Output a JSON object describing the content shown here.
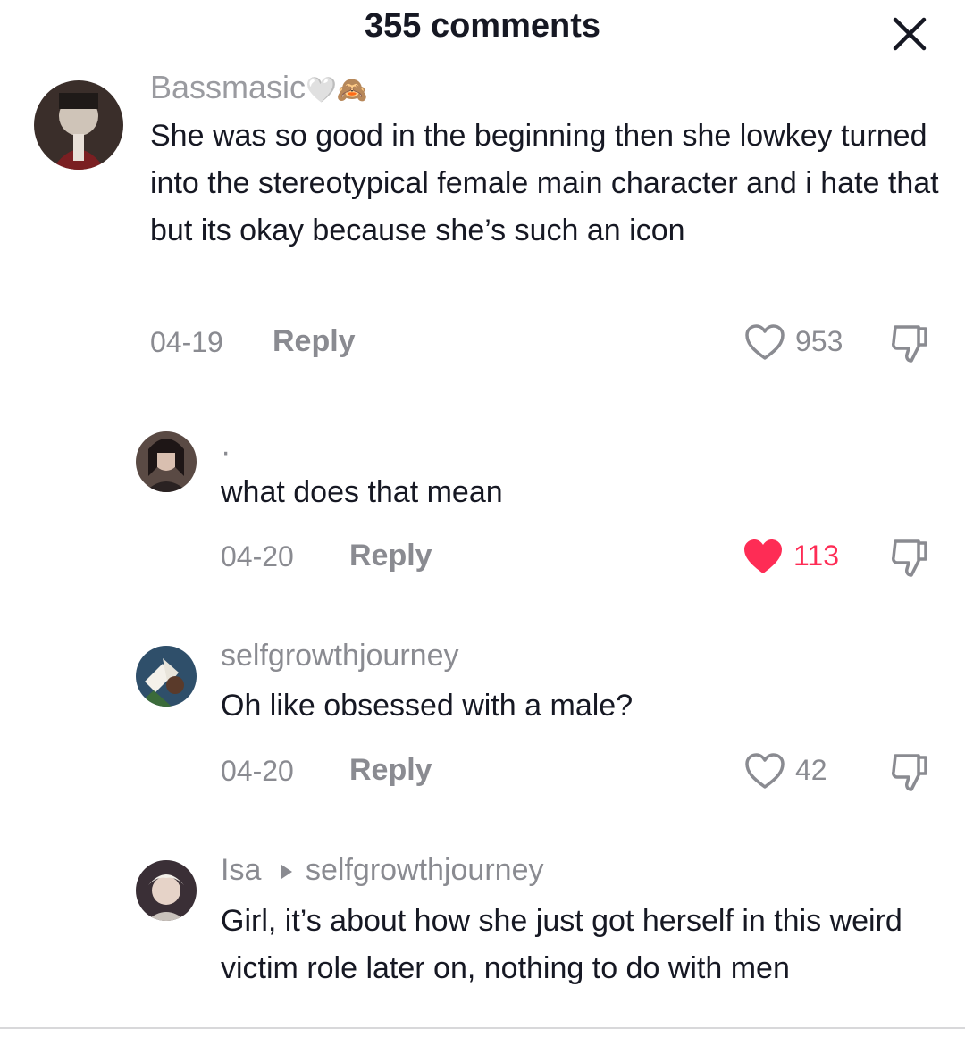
{
  "header": {
    "title": "355 comments",
    "close_icon": "close-icon"
  },
  "colors": {
    "liked": "#fe2c55",
    "muted": "#8a8b91",
    "text": "#161823"
  },
  "comments": [
    {
      "username": "Bassmasic",
      "username_emoji": "🤍🙈",
      "text": "She was so good in the beginning then she lowkey turned into the stereotypical female main character and i hate that but its okay because she’s such an icon",
      "date": "04-19",
      "reply_label": "Reply",
      "likes": "953",
      "liked": false
    },
    {
      "username": "·",
      "text": "what does that mean",
      "date": "04-20",
      "reply_label": "Reply",
      "likes": "113",
      "liked": true
    },
    {
      "username": "selfgrowthjourney",
      "text": "Oh like obsessed with a male?",
      "date": "04-20",
      "reply_label": "Reply",
      "likes": "42",
      "liked": false
    },
    {
      "username": "Isa",
      "reply_to": "selfgrowthjourney",
      "text": "Girl, it’s about how she just got herself in this weird victim role later on, nothing to do with men"
    }
  ]
}
